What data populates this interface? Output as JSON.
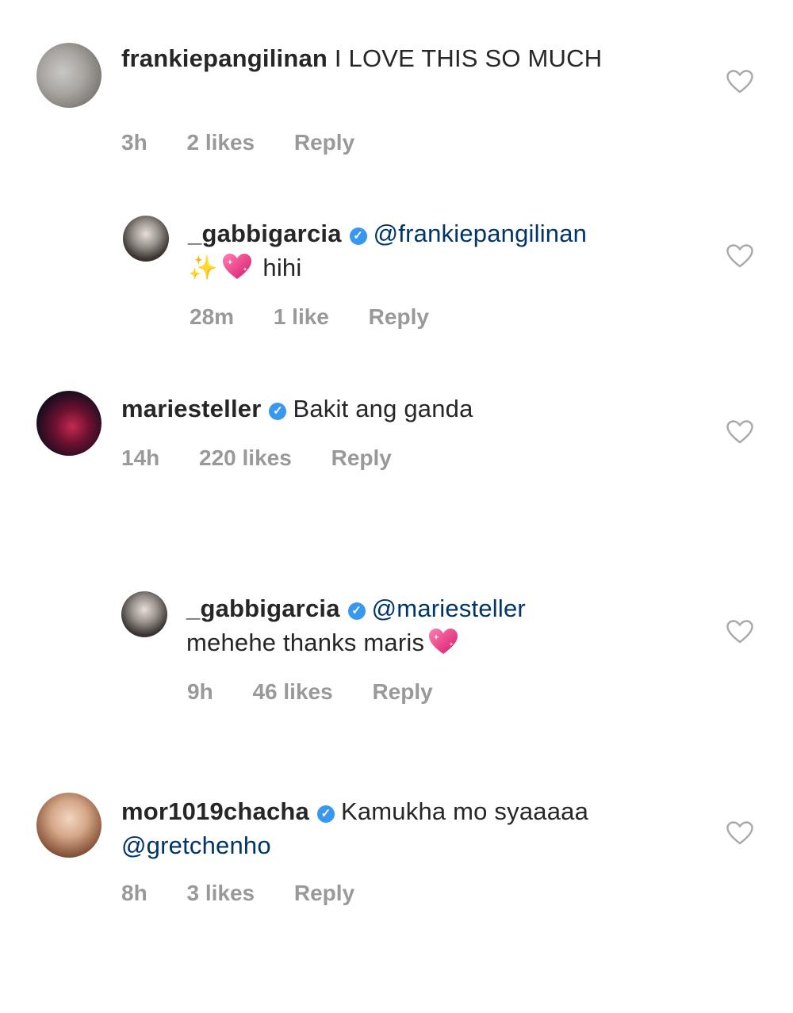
{
  "comments": [
    {
      "username": "frankiepangilinan",
      "verified": false,
      "text": "I LOVE THIS SO MUCH",
      "time": "3h",
      "likes": "2 likes",
      "reply": "Reply",
      "avatar_icon": "profile-photo"
    },
    {
      "username": "_gabbigarcia",
      "verified": true,
      "mention": "@frankiepangilinan",
      "text": "hihi",
      "emoji": [
        "sparkles-icon",
        "sparkling-heart-icon"
      ],
      "time": "28m",
      "likes": "1 like",
      "reply": "Reply",
      "avatar_icon": "profile-photo"
    },
    {
      "username": "mariesteller",
      "verified": true,
      "text": "Bakit ang ganda",
      "time": "14h",
      "likes": "220 likes",
      "reply": "Reply",
      "avatar_icon": "profile-photo"
    },
    {
      "username": "_gabbigarcia",
      "verified": true,
      "mention": "@mariesteller",
      "text": "mehehe thanks maris",
      "emoji": [
        "sparkling-heart-icon"
      ],
      "time": "9h",
      "likes": "46 likes",
      "reply": "Reply",
      "avatar_icon": "profile-photo"
    },
    {
      "username": "mor1019chacha",
      "verified": true,
      "text": "Kamukha mo syaaaaa",
      "mention": "@gretchenho",
      "time": "8h",
      "likes": "3 likes",
      "reply": "Reply",
      "avatar_icon": "profile-photo"
    }
  ],
  "colors": {
    "text": "#262626",
    "meta": "#999999",
    "mention": "#003569",
    "verified_badge": "#3897f0",
    "heart_emoji": "#e8457a"
  }
}
